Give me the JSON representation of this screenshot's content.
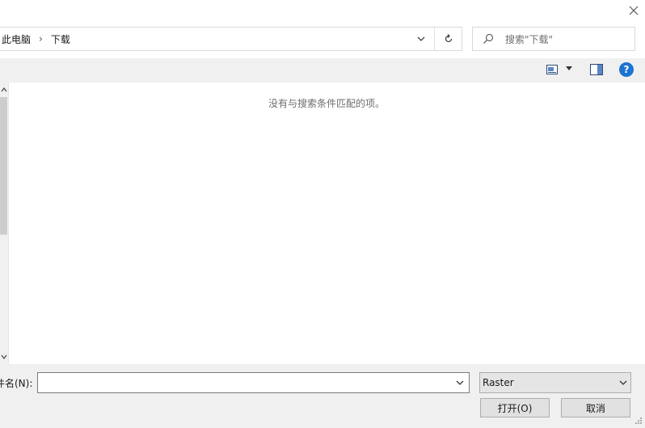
{
  "address": {
    "crumbs": [
      "此电脑",
      "下载"
    ],
    "separator": "›"
  },
  "search": {
    "placeholder": "搜索\"下载\""
  },
  "content": {
    "empty_message": "没有与搜索条件匹配的项。"
  },
  "footer": {
    "filename_label": "件名(N):",
    "filename_value": "",
    "filetype_value": "Raster",
    "open_label": "打开(O)",
    "cancel_label": "取消"
  },
  "toolbar": {
    "help_label": "?"
  },
  "icons": {
    "close": "close-icon",
    "dropdown": "chevron-down-icon",
    "refresh": "refresh-icon",
    "search": "search-icon",
    "view": "view-icon",
    "preview": "preview-pane-icon",
    "help": "help-icon"
  },
  "colors": {
    "help_blue": "#1e73d2",
    "panel_bg": "#f0f0f0"
  }
}
